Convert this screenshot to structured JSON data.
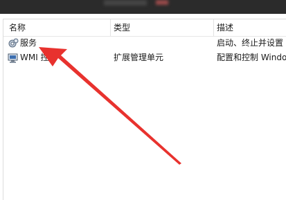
{
  "columns": {
    "name": "名称",
    "type": "类型",
    "description": "描述"
  },
  "rows": [
    {
      "icon": "services-gear-icon",
      "name": "服务",
      "type": "",
      "description": "启动、终止并设置"
    },
    {
      "icon": "wmi-control-icon",
      "name": "WMI 控件",
      "type": "扩展管理单元",
      "description": "配置和控制 Windo"
    }
  ],
  "annotation": {
    "color": "#e8322e"
  }
}
